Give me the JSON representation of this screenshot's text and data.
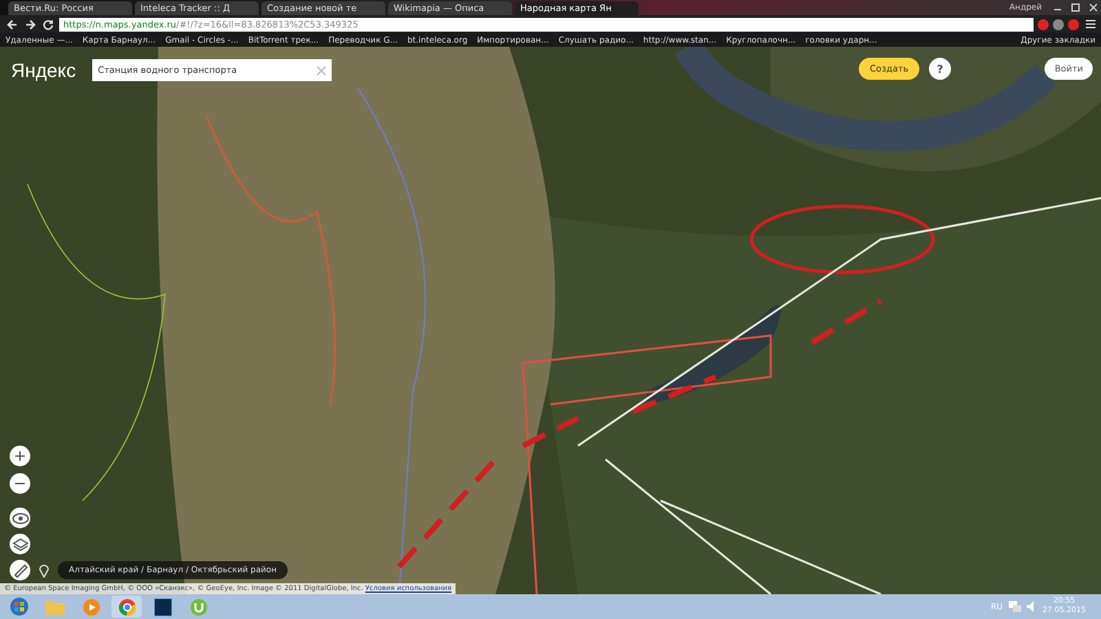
{
  "browser": {
    "tabs": [
      {
        "label": "Вести.Ru: Россия",
        "selected": false
      },
      {
        "label": "Inteleca Tracker :: Д",
        "selected": false
      },
      {
        "label": "Создание новой те",
        "selected": false
      },
      {
        "label": "Wikimapia — Описа",
        "selected": false
      },
      {
        "label": "Народная карта Ян",
        "selected": true
      }
    ],
    "user": "Андрей",
    "address": {
      "host": "https://n.maps.yandex.ru",
      "rest": "/#!/?z=16&ll=83.826813%2C53.349325"
    },
    "bookmarks": [
      "Удаленные —...",
      "Карта Барнаул...",
      "Gmail - Circles -...",
      "BitTorrent трек...",
      "Переводчик G...",
      "bt.inteleca.org",
      "Импортирован...",
      "Слушать радио...",
      "http://www.stan...",
      "Круглопалочн...",
      "головки ударн..."
    ],
    "other_bookmarks": "Другие закладки"
  },
  "map": {
    "logo": "Яндекс",
    "search": {
      "value": "Станция водного транспорта"
    },
    "create_button": "Создать",
    "help_button": "?",
    "login_button": "Войти",
    "zoom_in": "+",
    "zoom_out": "−",
    "breadcrumb": "Алтайский край / Барнаул / Октябрьский район",
    "copyright": "© European Space Imaging GmbH, © ООО «Сканэкс», © GeoEye, Inc. Image © 2011 DigitalGlobe, Inc.",
    "terms_link": "Условия использования"
  },
  "taskbar": {
    "language": "RU",
    "time": "20:55",
    "date": "27.05.2015"
  }
}
